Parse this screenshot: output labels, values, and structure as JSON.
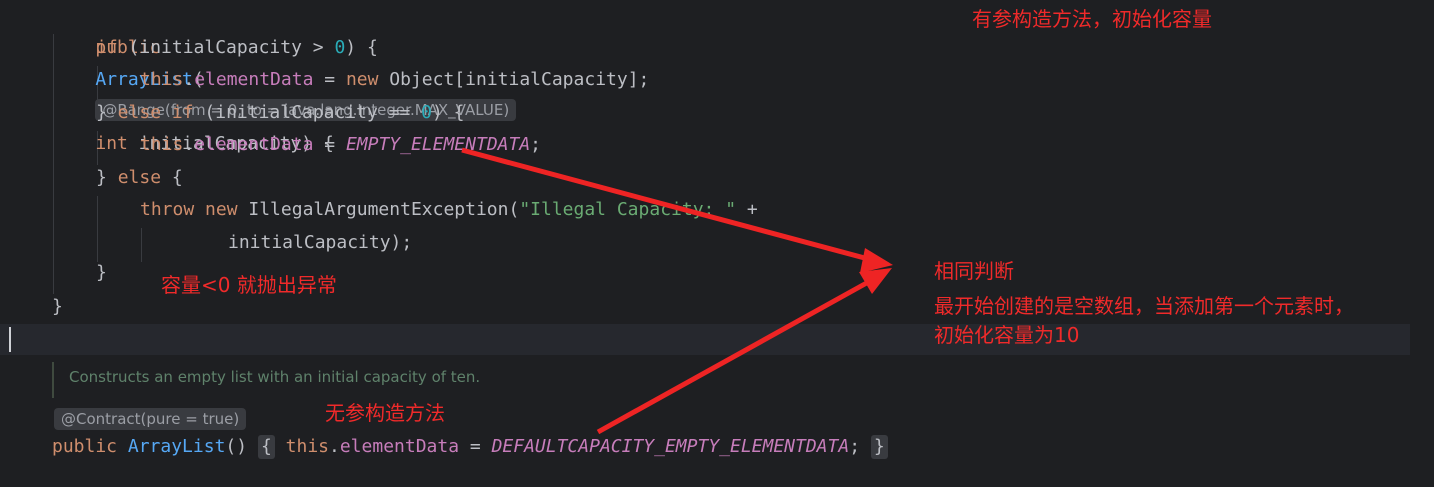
{
  "code": {
    "line1": {
      "kw_public": "public",
      "name": "ArrayList",
      "paren_open": "(",
      "inlay_hint": "@Range(from = 0, to = java.lang.Integer.MAX_VALUE)",
      "kw_int": "int",
      "param": " initialCapacity) {"
    },
    "line2": {
      "kw_if": "if",
      "cond_a": " (initialCapacity > ",
      "zero": "0",
      "cond_b": ") {"
    },
    "line3": {
      "kw_this": "this",
      "dot": ".",
      "field": "elementData",
      "eq": " = ",
      "kw_new": "new",
      "rest": " Object[initialCapacity];"
    },
    "line4": {
      "brace": "} ",
      "kw_else": "else",
      "sp": " ",
      "kw_if": "if",
      "cond_a": " (initialCapacity == ",
      "zero": "0",
      "cond_b": ") {"
    },
    "line5": {
      "kw_this": "this",
      "dot": ".",
      "field": "elementData",
      "eq": " = ",
      "const": "EMPTY_ELEMENTDATA",
      "semi": ";"
    },
    "line6": {
      "brace": "} ",
      "kw_else": "else",
      "rest": " {"
    },
    "line7": {
      "kw_throw": "throw",
      "sp": " ",
      "kw_new": "new",
      "cls": " IllegalArgumentException(",
      "str": "\"Illegal Capacity: \"",
      "plus": " +"
    },
    "line8": {
      "text": "initialCapacity);"
    },
    "line9": {
      "text": "}"
    },
    "line10": {
      "text": "}"
    },
    "doc_comment": "Constructs an empty list with an initial capacity of ten.",
    "annotation": "@Contract(pure = true)",
    "line_last": {
      "kw_public": "public",
      "name": "ArrayList",
      "parens": "()",
      "fold_open": "{",
      "kw_this": "this",
      "dot": ".",
      "field": "elementData",
      "eq": " = ",
      "const": "DEFAULTCAPACITY_EMPTY_ELEMENTDATA",
      "semi": ";",
      "fold_close": "}"
    }
  },
  "notes": {
    "param_ctor": "有参构造方法，初始化容量",
    "negative": "容量<0 就抛出异常",
    "same_judge": "相同判断",
    "explain_line1": "最开始创建的是空数组，当添加第一个元素时，",
    "explain_line2": "初始化容量为10",
    "no_arg_ctor": "无参构造方法"
  },
  "colors": {
    "background": "#1e1f22",
    "keyword": "#cf8e6d",
    "method": "#56a8f5",
    "field": "#c77dbb",
    "number": "#2aacb8",
    "string": "#6aab73",
    "annotation_red": "#f02a2a"
  }
}
